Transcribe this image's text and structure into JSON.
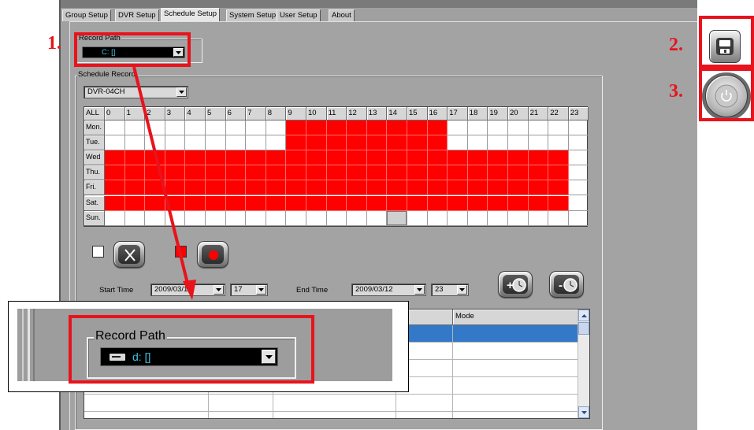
{
  "tabs": [
    {
      "label": "Group Setup"
    },
    {
      "label": "DVR Setup"
    },
    {
      "label": "Schedule Setup"
    },
    {
      "label": "System Setup"
    },
    {
      "label": "User Setup"
    },
    {
      "label": "About"
    }
  ],
  "active_tab": "Schedule Setup",
  "record_path": {
    "legend": "Record Path",
    "value": "C: []"
  },
  "schedule": {
    "legend": "Schedule Record",
    "channel": "DVR-04CH",
    "all_label": "ALL",
    "hours": [
      "0",
      "1",
      "2",
      "3",
      "4",
      "5",
      "6",
      "7",
      "8",
      "9",
      "10",
      "11",
      "12",
      "13",
      "14",
      "15",
      "16",
      "17",
      "18",
      "19",
      "20",
      "21",
      "22",
      "23"
    ],
    "days": [
      "Mon.",
      "Tue.",
      "Wed",
      "Thu.",
      "Fri.",
      "Sat.",
      "Sun."
    ],
    "record_color": "#ff0000",
    "active_hours": [
      [
        9,
        10,
        11,
        12,
        13,
        14,
        15,
        16
      ],
      [
        9,
        10,
        11,
        12,
        13,
        14,
        15,
        16
      ],
      [
        0,
        1,
        2,
        3,
        4,
        5,
        6,
        7,
        8,
        9,
        10,
        11,
        12,
        13,
        14,
        15,
        16,
        17,
        18,
        19,
        20,
        21,
        22
      ],
      [
        0,
        1,
        2,
        3,
        4,
        5,
        6,
        7,
        8,
        9,
        10,
        11,
        12,
        13,
        14,
        15,
        16,
        17,
        18,
        19,
        20,
        21,
        22
      ],
      [
        0,
        1,
        2,
        3,
        4,
        5,
        6,
        7,
        8,
        9,
        10,
        11,
        12,
        13,
        14,
        15,
        16,
        17,
        18,
        19,
        20,
        21,
        22
      ],
      [
        0,
        1,
        2,
        3,
        4,
        5,
        6,
        7,
        8,
        9,
        10,
        11,
        12,
        13,
        14,
        15,
        16,
        17,
        18,
        19,
        20,
        21,
        22
      ],
      []
    ],
    "selected_cell": {
      "day": 6,
      "hour": 14
    }
  },
  "time_range": {
    "start_label": "Start Time",
    "start_date": "2009/03/12",
    "start_hour": "17",
    "end_label": "End Time",
    "end_date": "2009/03/12",
    "end_hour": "23"
  },
  "list": {
    "col_partial": "e",
    "col_mode": "Mode",
    "row_count": 5,
    "selected_row": 0,
    "selection_color": "#3478c8"
  },
  "inset": {
    "legend": "Record Path",
    "value": "d: []"
  },
  "annotations": {
    "n1": "1.",
    "n2": "2.",
    "n3": "3.",
    "color": "#e8131c"
  },
  "icons": {
    "clear": "x-icon",
    "record": "record-dot-icon",
    "add_time": "clock-plus-icon",
    "remove_time": "clock-minus-icon",
    "save": "floppy-icon",
    "power": "power-icon",
    "drive": "drive-icon"
  }
}
